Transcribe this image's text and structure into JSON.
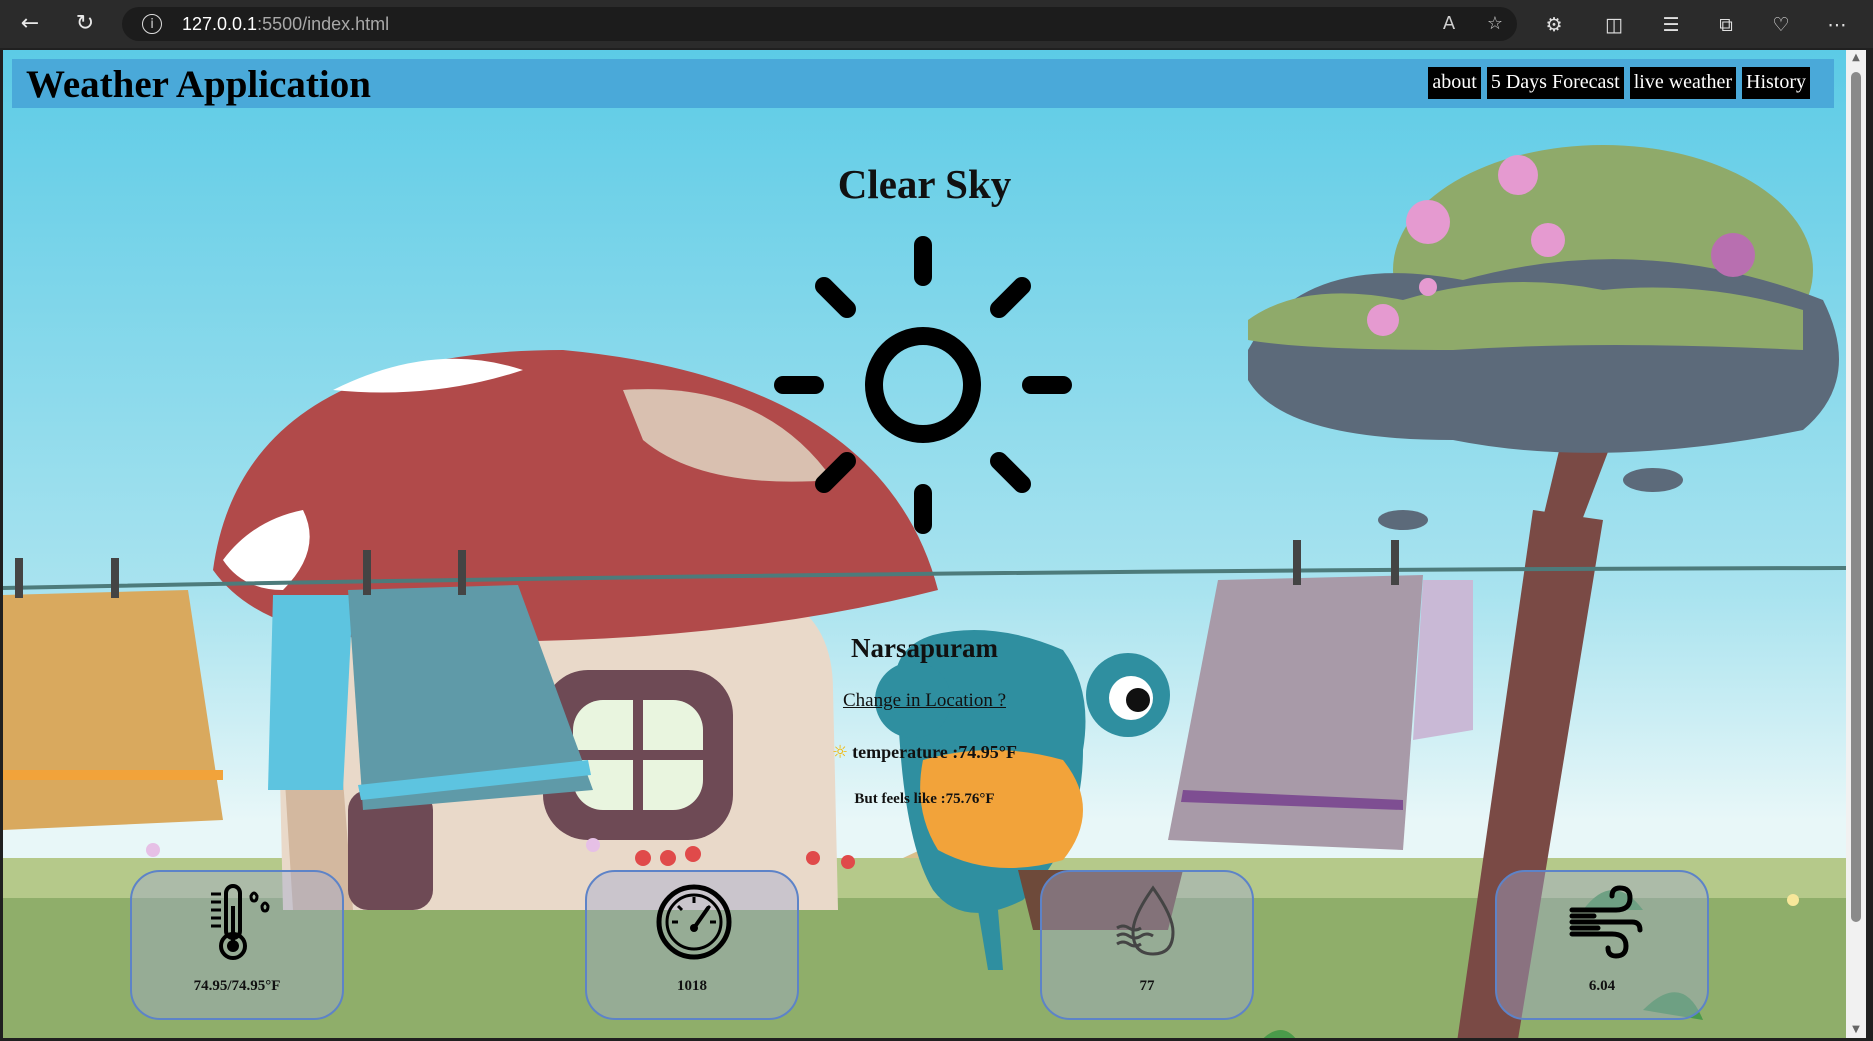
{
  "browser": {
    "url_host": "127.0.0.1",
    "url_rest": ":5500/index.html"
  },
  "header": {
    "title": "Weather Application",
    "nav": [
      "about",
      "5 Days Forecast",
      "live weather",
      "History"
    ]
  },
  "weather": {
    "description": "Clear Sky",
    "icon": "sun-icon",
    "city": "Narsapuram",
    "change_location": "Change in Location ?",
    "temperature": "temperature :74.95°F",
    "feels_like": "But feels like :75.76°F"
  },
  "cards": [
    {
      "icon": "thermometer-icon",
      "value": "74.95/74.95°F"
    },
    {
      "icon": "gauge-icon",
      "value": "1018"
    },
    {
      "icon": "humidity-icon",
      "value": "77"
    },
    {
      "icon": "wind-icon",
      "value": "6.04"
    }
  ],
  "colors": {
    "header_bg": "#4aa9d9",
    "nav_bg": "#000000",
    "card_border": "#5d83c8"
  }
}
